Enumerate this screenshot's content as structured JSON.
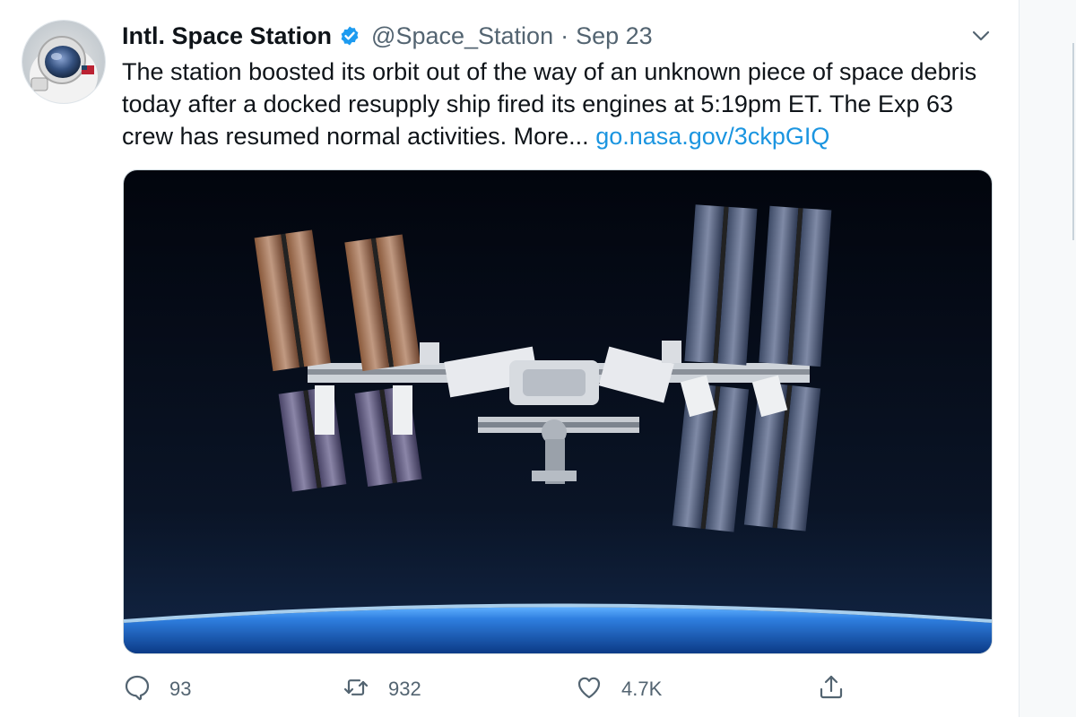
{
  "tweet": {
    "author_name": "Intl. Space Station",
    "handle": "@Space_Station",
    "separator": "·",
    "date": "Sep 23",
    "text": "The station boosted its orbit out of the way of an unknown piece of space debris today after a docked resupply ship fired its engines at 5:19pm ET. The Exp 63 crew has resumed normal activities. More... ",
    "link": "go.nasa.gov/3ckpGIQ"
  },
  "actions": {
    "replies": "93",
    "retweets": "932",
    "likes": "4.7K"
  },
  "icons": {
    "verified": "verified-badge-icon",
    "caret": "chevron-down-icon",
    "reply": "comment-icon",
    "retweet": "retweet-icon",
    "like": "heart-icon",
    "share": "share-icon"
  },
  "colors": {
    "link": "#1b95e0",
    "verified": "#1d9bf0",
    "secondary_text": "#536471",
    "icon": "#536471"
  }
}
